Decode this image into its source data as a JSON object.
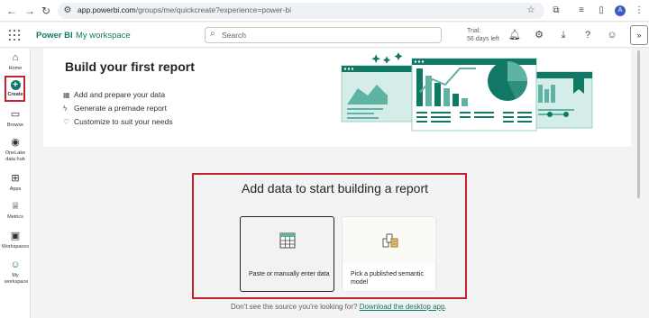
{
  "browser": {
    "url_host": "app.powerbi.com",
    "url_path": "/groups/me/quickcreate?experience=power-bi",
    "avatar_letter": "A"
  },
  "header": {
    "brand": "Power BI",
    "workspace": "My workspace",
    "search_placeholder": "Search",
    "trial_line1": "Trial:",
    "trial_line2": "56 days left"
  },
  "rail": {
    "items": [
      {
        "label": "Home",
        "icon": "home-icon"
      },
      {
        "label": "Create",
        "icon": "plus-circle-icon"
      },
      {
        "label": "Browse",
        "icon": "folder-icon"
      },
      {
        "label": "OneLake data hub",
        "icon": "onelake-icon"
      },
      {
        "label": "Apps",
        "icon": "apps-icon"
      },
      {
        "label": "Metrics",
        "icon": "trophy-icon"
      },
      {
        "label": "Workspaces",
        "icon": "workspaces-icon"
      },
      {
        "label": "My workspace",
        "icon": "person-icon"
      }
    ]
  },
  "banner": {
    "title": "Build your first report",
    "features": [
      {
        "text": "Add and prepare your data",
        "icon": "table-icon"
      },
      {
        "text": "Generate a premade report",
        "icon": "sparkle-icon"
      },
      {
        "text": "Customize to suit your needs",
        "icon": "tools-icon"
      }
    ]
  },
  "add_data": {
    "title": "Add data to start building a report",
    "cards": [
      {
        "label": "Paste or manually enter data",
        "icon": "table-grid-icon"
      },
      {
        "label": "Pick a published semantic model",
        "icon": "semantic-model-icon"
      }
    ]
  },
  "footer": {
    "question": "Don't see the source you're looking for?",
    "link": "Download the desktop app",
    "period": "."
  },
  "colors": {
    "accent": "#117865",
    "highlight_border": "#c4222f"
  }
}
